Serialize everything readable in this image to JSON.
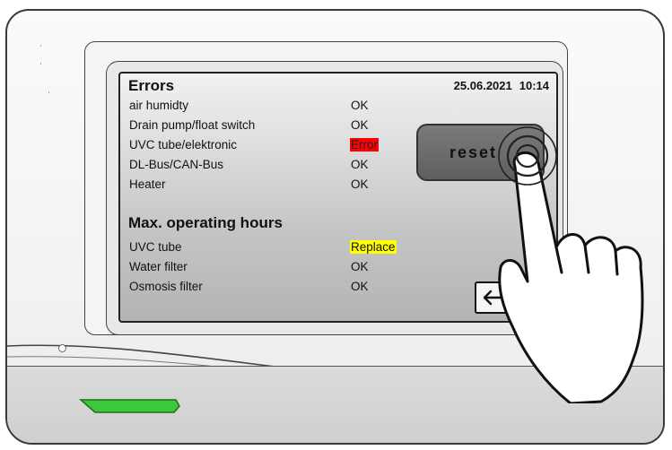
{
  "screen": {
    "title": "Errors",
    "date": "25.06.2021",
    "time": "10:14",
    "errors": [
      {
        "label": "air humidty",
        "status": "OK",
        "highlight": "none"
      },
      {
        "label": "Drain pump/float switch",
        "status": "OK",
        "highlight": "none"
      },
      {
        "label": "UVC tube/elektronic",
        "status": "Error",
        "highlight": "#ff0000"
      },
      {
        "label": "DL-Bus/CAN-Bus",
        "status": "OK",
        "highlight": "none"
      },
      {
        "label": "Heater",
        "status": "OK",
        "highlight": "none"
      }
    ],
    "section_title": "Max. operating hours",
    "operating_hours": [
      {
        "label": "UVC tube",
        "status": "Replace",
        "highlight": "#ffff00"
      },
      {
        "label": "Water filter",
        "status": "OK",
        "highlight": "none"
      },
      {
        "label": "Osmosis filter",
        "status": "OK",
        "highlight": "none"
      }
    ],
    "reset_label": "reset",
    "back_icon": "arrow-left-icon"
  },
  "device": {
    "status_led_color": "#3cc83c",
    "housing_color": "#f2f2f2"
  },
  "overlay": {
    "gesture_icon": "pointing-hand-icon"
  }
}
